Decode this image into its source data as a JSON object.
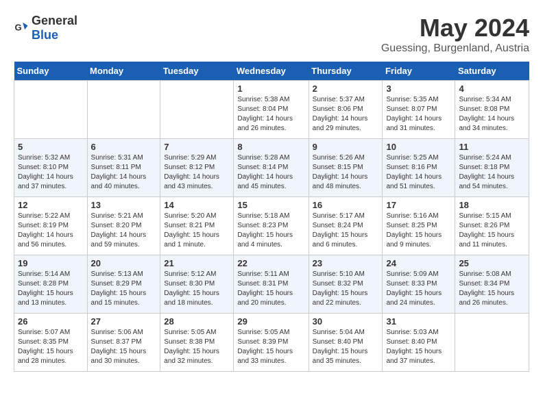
{
  "header": {
    "logo_general": "General",
    "logo_blue": "Blue",
    "title": "May 2024",
    "location": "Guessing, Burgenland, Austria"
  },
  "weekdays": [
    "Sunday",
    "Monday",
    "Tuesday",
    "Wednesday",
    "Thursday",
    "Friday",
    "Saturday"
  ],
  "weeks": [
    [
      {
        "day": "",
        "info": ""
      },
      {
        "day": "",
        "info": ""
      },
      {
        "day": "",
        "info": ""
      },
      {
        "day": "1",
        "info": "Sunrise: 5:38 AM\nSunset: 8:04 PM\nDaylight: 14 hours\nand 26 minutes."
      },
      {
        "day": "2",
        "info": "Sunrise: 5:37 AM\nSunset: 8:06 PM\nDaylight: 14 hours\nand 29 minutes."
      },
      {
        "day": "3",
        "info": "Sunrise: 5:35 AM\nSunset: 8:07 PM\nDaylight: 14 hours\nand 31 minutes."
      },
      {
        "day": "4",
        "info": "Sunrise: 5:34 AM\nSunset: 8:08 PM\nDaylight: 14 hours\nand 34 minutes."
      }
    ],
    [
      {
        "day": "5",
        "info": "Sunrise: 5:32 AM\nSunset: 8:10 PM\nDaylight: 14 hours\nand 37 minutes."
      },
      {
        "day": "6",
        "info": "Sunrise: 5:31 AM\nSunset: 8:11 PM\nDaylight: 14 hours\nand 40 minutes."
      },
      {
        "day": "7",
        "info": "Sunrise: 5:29 AM\nSunset: 8:12 PM\nDaylight: 14 hours\nand 43 minutes."
      },
      {
        "day": "8",
        "info": "Sunrise: 5:28 AM\nSunset: 8:14 PM\nDaylight: 14 hours\nand 45 minutes."
      },
      {
        "day": "9",
        "info": "Sunrise: 5:26 AM\nSunset: 8:15 PM\nDaylight: 14 hours\nand 48 minutes."
      },
      {
        "day": "10",
        "info": "Sunrise: 5:25 AM\nSunset: 8:16 PM\nDaylight: 14 hours\nand 51 minutes."
      },
      {
        "day": "11",
        "info": "Sunrise: 5:24 AM\nSunset: 8:18 PM\nDaylight: 14 hours\nand 54 minutes."
      }
    ],
    [
      {
        "day": "12",
        "info": "Sunrise: 5:22 AM\nSunset: 8:19 PM\nDaylight: 14 hours\nand 56 minutes."
      },
      {
        "day": "13",
        "info": "Sunrise: 5:21 AM\nSunset: 8:20 PM\nDaylight: 14 hours\nand 59 minutes."
      },
      {
        "day": "14",
        "info": "Sunrise: 5:20 AM\nSunset: 8:21 PM\nDaylight: 15 hours\nand 1 minute."
      },
      {
        "day": "15",
        "info": "Sunrise: 5:18 AM\nSunset: 8:23 PM\nDaylight: 15 hours\nand 4 minutes."
      },
      {
        "day": "16",
        "info": "Sunrise: 5:17 AM\nSunset: 8:24 PM\nDaylight: 15 hours\nand 6 minutes."
      },
      {
        "day": "17",
        "info": "Sunrise: 5:16 AM\nSunset: 8:25 PM\nDaylight: 15 hours\nand 9 minutes."
      },
      {
        "day": "18",
        "info": "Sunrise: 5:15 AM\nSunset: 8:26 PM\nDaylight: 15 hours\nand 11 minutes."
      }
    ],
    [
      {
        "day": "19",
        "info": "Sunrise: 5:14 AM\nSunset: 8:28 PM\nDaylight: 15 hours\nand 13 minutes."
      },
      {
        "day": "20",
        "info": "Sunrise: 5:13 AM\nSunset: 8:29 PM\nDaylight: 15 hours\nand 15 minutes."
      },
      {
        "day": "21",
        "info": "Sunrise: 5:12 AM\nSunset: 8:30 PM\nDaylight: 15 hours\nand 18 minutes."
      },
      {
        "day": "22",
        "info": "Sunrise: 5:11 AM\nSunset: 8:31 PM\nDaylight: 15 hours\nand 20 minutes."
      },
      {
        "day": "23",
        "info": "Sunrise: 5:10 AM\nSunset: 8:32 PM\nDaylight: 15 hours\nand 22 minutes."
      },
      {
        "day": "24",
        "info": "Sunrise: 5:09 AM\nSunset: 8:33 PM\nDaylight: 15 hours\nand 24 minutes."
      },
      {
        "day": "25",
        "info": "Sunrise: 5:08 AM\nSunset: 8:34 PM\nDaylight: 15 hours\nand 26 minutes."
      }
    ],
    [
      {
        "day": "26",
        "info": "Sunrise: 5:07 AM\nSunset: 8:35 PM\nDaylight: 15 hours\nand 28 minutes."
      },
      {
        "day": "27",
        "info": "Sunrise: 5:06 AM\nSunset: 8:37 PM\nDaylight: 15 hours\nand 30 minutes."
      },
      {
        "day": "28",
        "info": "Sunrise: 5:05 AM\nSunset: 8:38 PM\nDaylight: 15 hours\nand 32 minutes."
      },
      {
        "day": "29",
        "info": "Sunrise: 5:05 AM\nSunset: 8:39 PM\nDaylight: 15 hours\nand 33 minutes."
      },
      {
        "day": "30",
        "info": "Sunrise: 5:04 AM\nSunset: 8:40 PM\nDaylight: 15 hours\nand 35 minutes."
      },
      {
        "day": "31",
        "info": "Sunrise: 5:03 AM\nSunset: 8:40 PM\nDaylight: 15 hours\nand 37 minutes."
      },
      {
        "day": "",
        "info": ""
      }
    ]
  ]
}
